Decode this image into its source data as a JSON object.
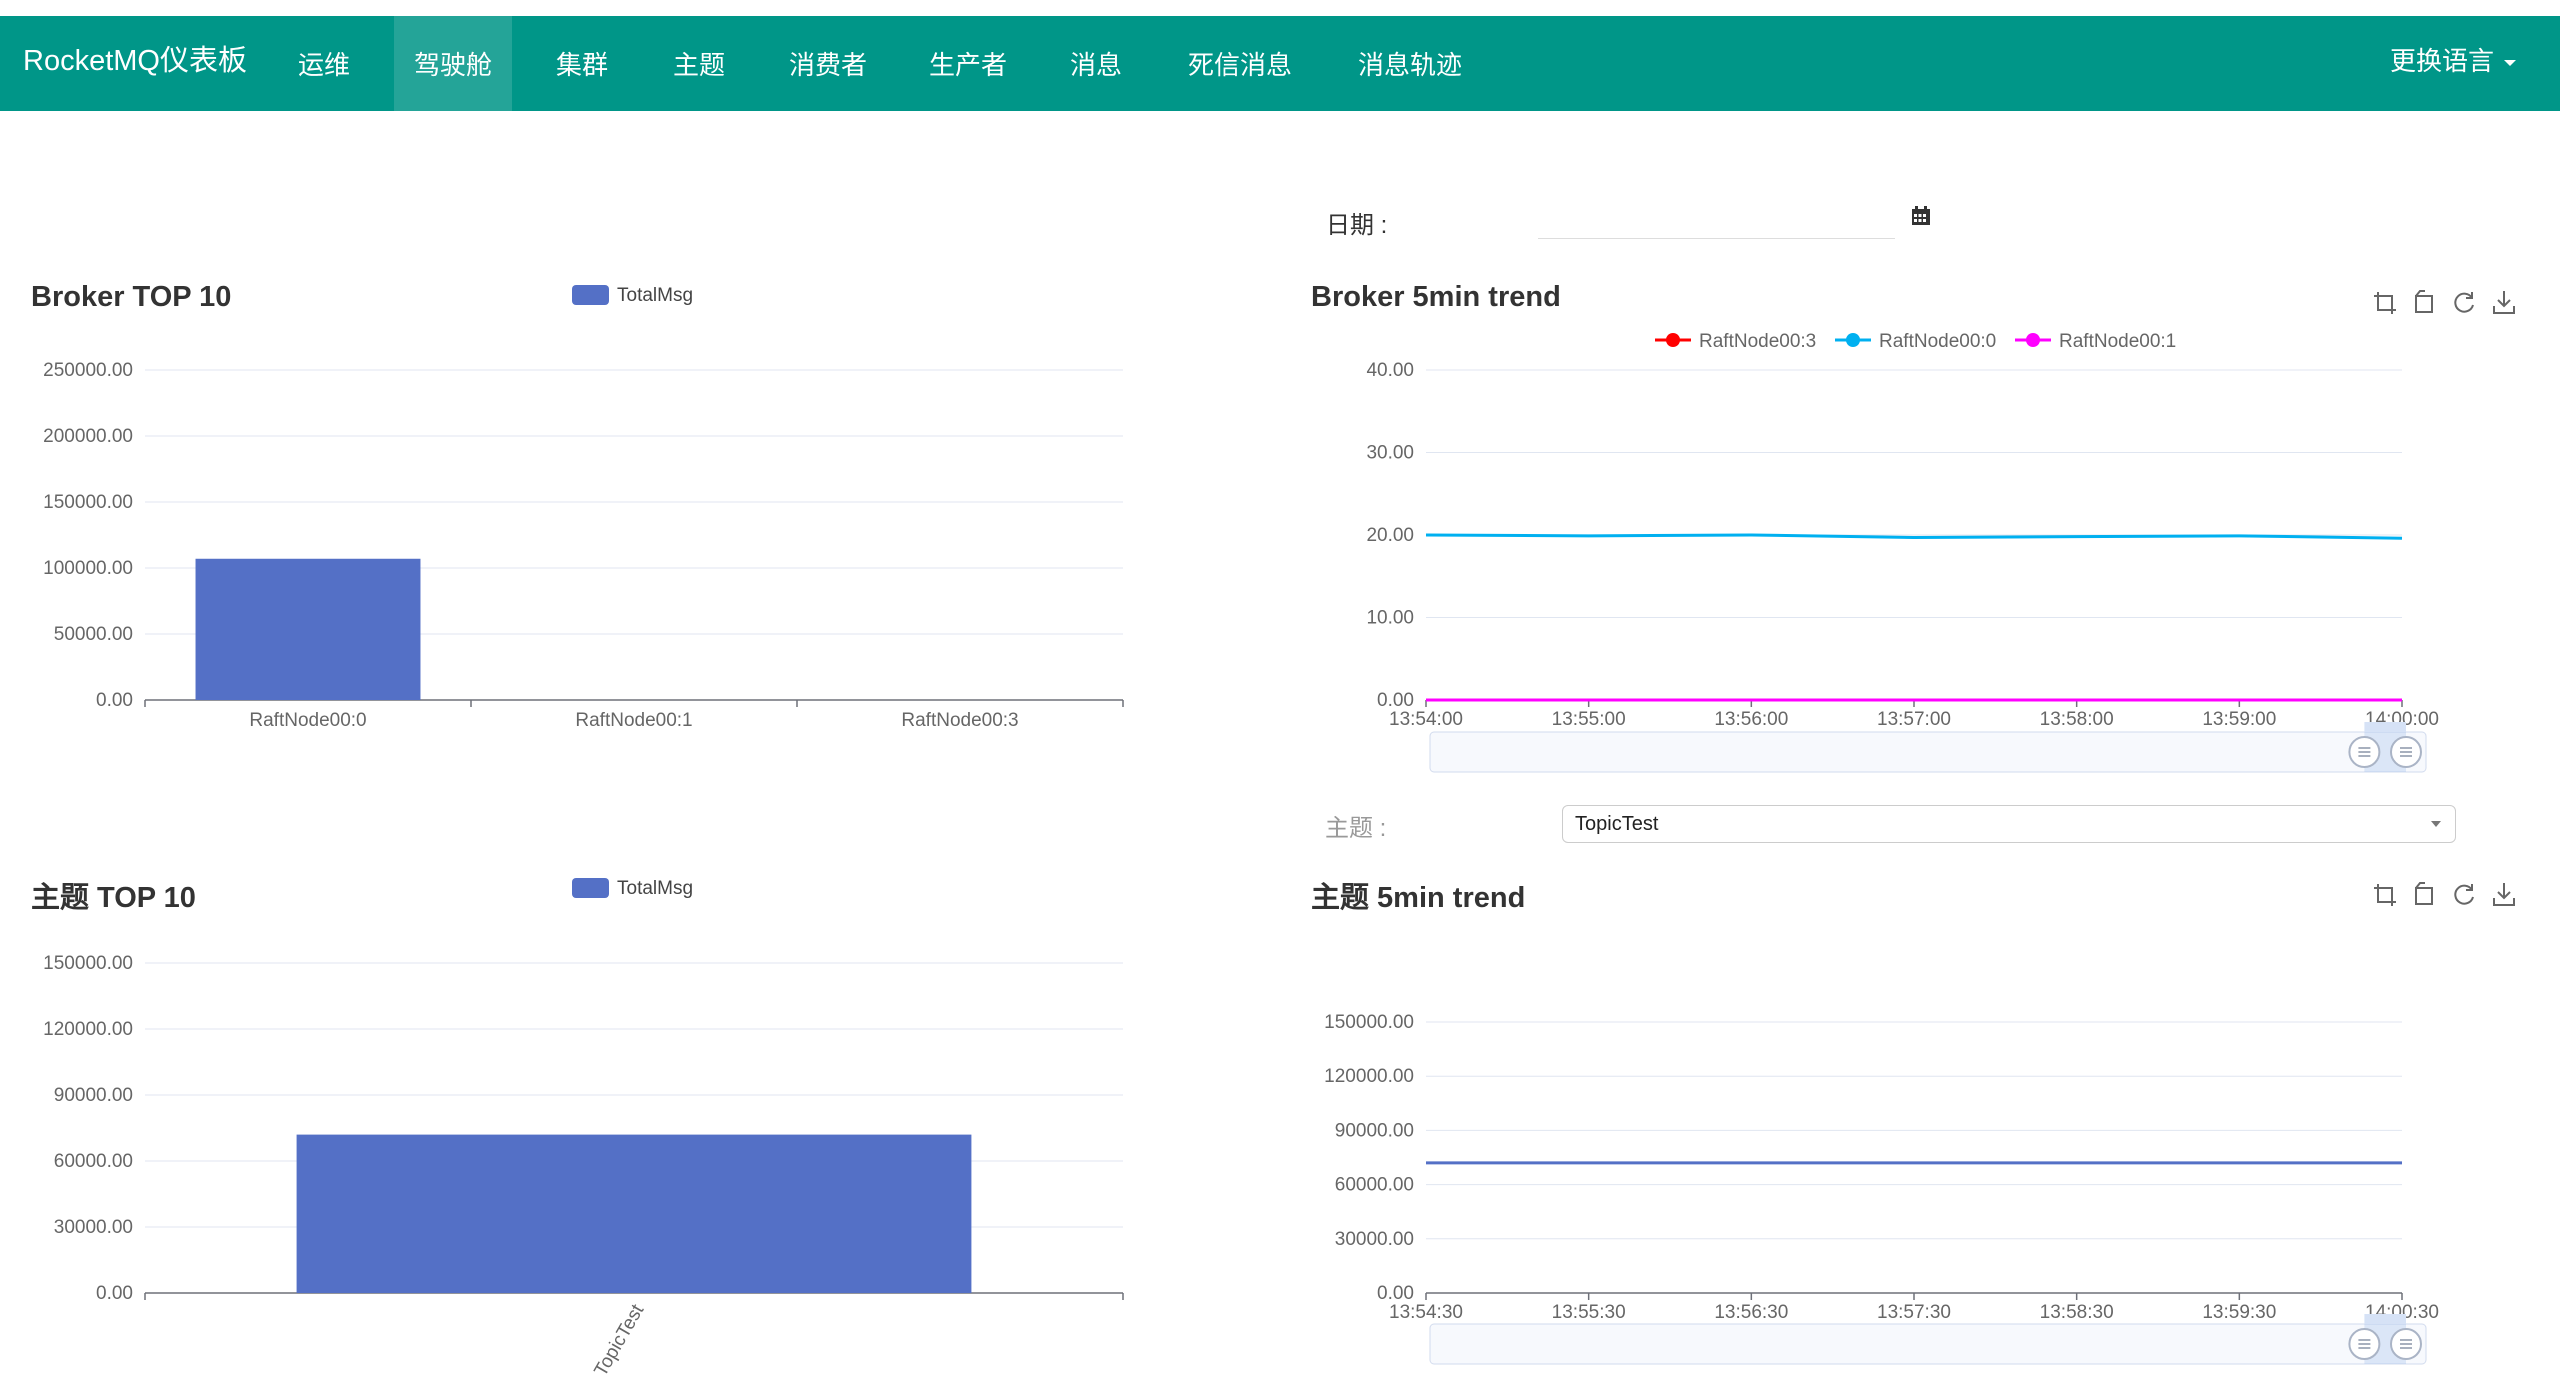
{
  "navbar": {
    "brand": "RocketMQ仪表板",
    "items": [
      {
        "label": "运维"
      },
      {
        "label": "驾驶舱"
      },
      {
        "label": "集群"
      },
      {
        "label": "主题"
      },
      {
        "label": "消费者"
      },
      {
        "label": "生产者"
      },
      {
        "label": "消息"
      },
      {
        "label": "死信消息"
      },
      {
        "label": "消息轨迹"
      }
    ],
    "active_index": 1,
    "language_menu": "更换语言"
  },
  "date_filter": {
    "label": "日期 :",
    "value": "",
    "icon": "calendar-icon"
  },
  "topic_filter": {
    "label": "主题 :",
    "selected": "TopicTest"
  },
  "colors": {
    "navbar": "#009688",
    "bar": "#5470c6"
  },
  "panels": {
    "broker_top10": {
      "title": "Broker TOP 10",
      "legend": "TotalMsg"
    },
    "broker_trend": {
      "title": "Broker 5min trend",
      "toolbox": [
        "zoom-icon",
        "zoom-reset-icon",
        "restore-icon",
        "download-icon"
      ]
    },
    "topic_top10": {
      "title": "主题 TOP 10",
      "legend": "TotalMsg"
    },
    "topic_trend": {
      "title": "主题 5min trend",
      "toolbox": [
        "zoom-icon",
        "zoom-reset-icon",
        "restore-icon",
        "download-icon"
      ]
    }
  },
  "chart_data": [
    {
      "id": "broker-top10",
      "type": "bar",
      "categories": [
        "RaftNode00:0",
        "RaftNode00:1",
        "RaftNode00:3"
      ],
      "series": [
        {
          "name": "TotalMsg",
          "values": [
            107000,
            0,
            0
          ]
        }
      ],
      "ylim": [
        0,
        250000
      ],
      "yticks": [
        "0.00",
        "50000.00",
        "100000.00",
        "150000.00",
        "200000.00",
        "250000.00"
      ],
      "legend": "top",
      "grid": true
    },
    {
      "id": "broker-trend",
      "type": "line",
      "x": [
        "13:54:00",
        "13:55:00",
        "13:56:00",
        "13:57:00",
        "13:58:00",
        "13:59:00",
        "14:00:00"
      ],
      "series": [
        {
          "name": "RaftNode00:3",
          "color": "#ff0000",
          "values": [
            0,
            0,
            0,
            0,
            0,
            0,
            0
          ]
        },
        {
          "name": "RaftNode00:0",
          "color": "#00b0f0",
          "values": [
            20.0,
            19.9,
            20.0,
            19.7,
            19.8,
            19.9,
            19.6
          ]
        },
        {
          "name": "RaftNode00:1",
          "color": "#ff00ff",
          "values": [
            0,
            0,
            0,
            0,
            0,
            0,
            0
          ]
        }
      ],
      "ylim": [
        0,
        40
      ],
      "yticks": [
        "0.00",
        "10.00",
        "20.00",
        "30.00",
        "40.00"
      ],
      "legend": "top",
      "grid": true,
      "datazoom": [
        0.9,
        1.0
      ]
    },
    {
      "id": "topic-top10",
      "type": "bar",
      "categories": [
        "TopicTest"
      ],
      "series": [
        {
          "name": "TotalMsg",
          "values": [
            72000
          ]
        }
      ],
      "ylim": [
        0,
        150000
      ],
      "yticks": [
        "0.00",
        "30000.00",
        "60000.00",
        "90000.00",
        "120000.00",
        "150000.00"
      ],
      "legend": "top",
      "grid": true,
      "rotate_labels": true
    },
    {
      "id": "topic-trend",
      "type": "line",
      "x": [
        "13:54:30",
        "13:55:30",
        "13:56:30",
        "13:57:30",
        "13:58:30",
        "13:59:30",
        "14:00:30"
      ],
      "series": [
        {
          "color": "#5470c6",
          "values": [
            72000,
            72000,
            72000,
            72000,
            72000,
            72000,
            72000
          ]
        }
      ],
      "ylim": [
        0,
        150000
      ],
      "yticks": [
        "0.00",
        "30000.00",
        "60000.00",
        "90000.00",
        "120000.00",
        "150000.00"
      ],
      "grid": true,
      "datazoom": [
        0.9,
        1.0
      ]
    }
  ]
}
